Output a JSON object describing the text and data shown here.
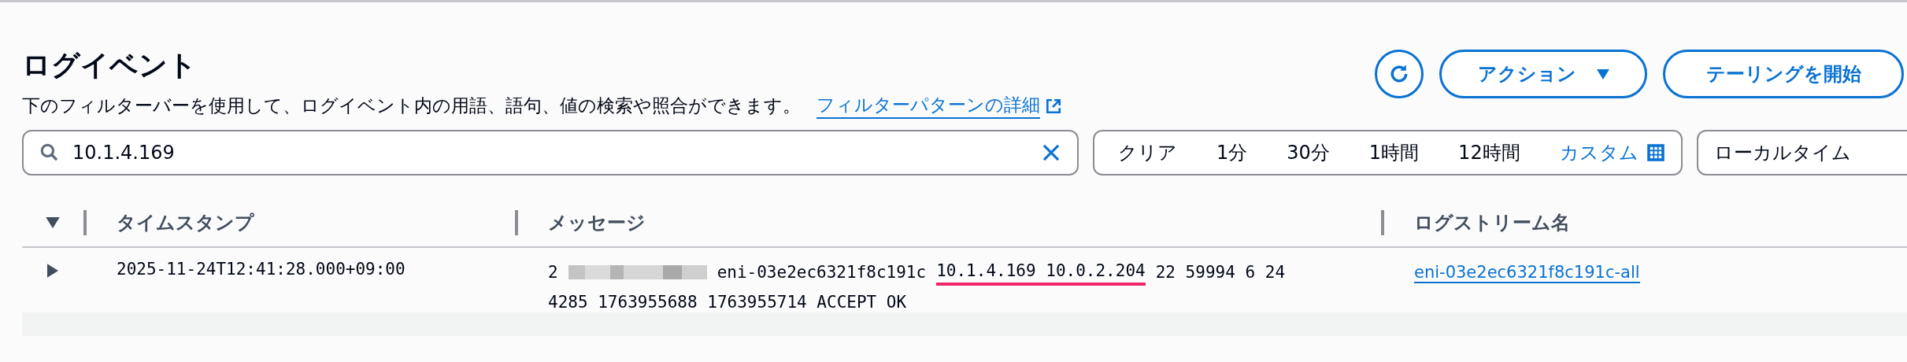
{
  "header": {
    "title": "ログイベント",
    "description": "下のフィルターバーを使用して、ログイベント内の用語、語句、値の検索や照合ができます。",
    "help_link": "フィルターパターンの詳細"
  },
  "actions": {
    "action_button": "アクション",
    "tail_button": "テーリングを開始"
  },
  "search": {
    "value": "10.1.4.169"
  },
  "time_range": [
    {
      "label": "クリア",
      "kind": "plain"
    },
    {
      "label": "1分",
      "kind": "plain"
    },
    {
      "label": "30分",
      "kind": "plain"
    },
    {
      "label": "1時間",
      "kind": "plain"
    },
    {
      "label": "12時間",
      "kind": "plain"
    },
    {
      "label": "カスタム",
      "kind": "custom"
    }
  ],
  "timezone": {
    "value": "ローカルタイム"
  },
  "table": {
    "columns": [
      "タイムスタンプ",
      "メッセージ",
      "ログストリーム名"
    ],
    "rows": [
      {
        "expanded": false,
        "timestamp": "2025-11-24T12:41:28.000+09:00",
        "message_lines": [
          [
            {
              "kind": "text",
              "text": "2"
            },
            {
              "kind": "redacted"
            },
            {
              "kind": "text",
              "text": "eni-03e2ec6321f8c191c"
            },
            {
              "kind": "match",
              "text": "10.1.4.169 10.0.2.204"
            },
            {
              "kind": "text",
              "text": "22 59994 6 24"
            }
          ],
          [
            {
              "kind": "text",
              "text": "4285 1763955688 1763955714 ACCEPT OK"
            }
          ]
        ],
        "log_stream": "eni-03e2ec6321f8c191c-all"
      }
    ]
  }
}
